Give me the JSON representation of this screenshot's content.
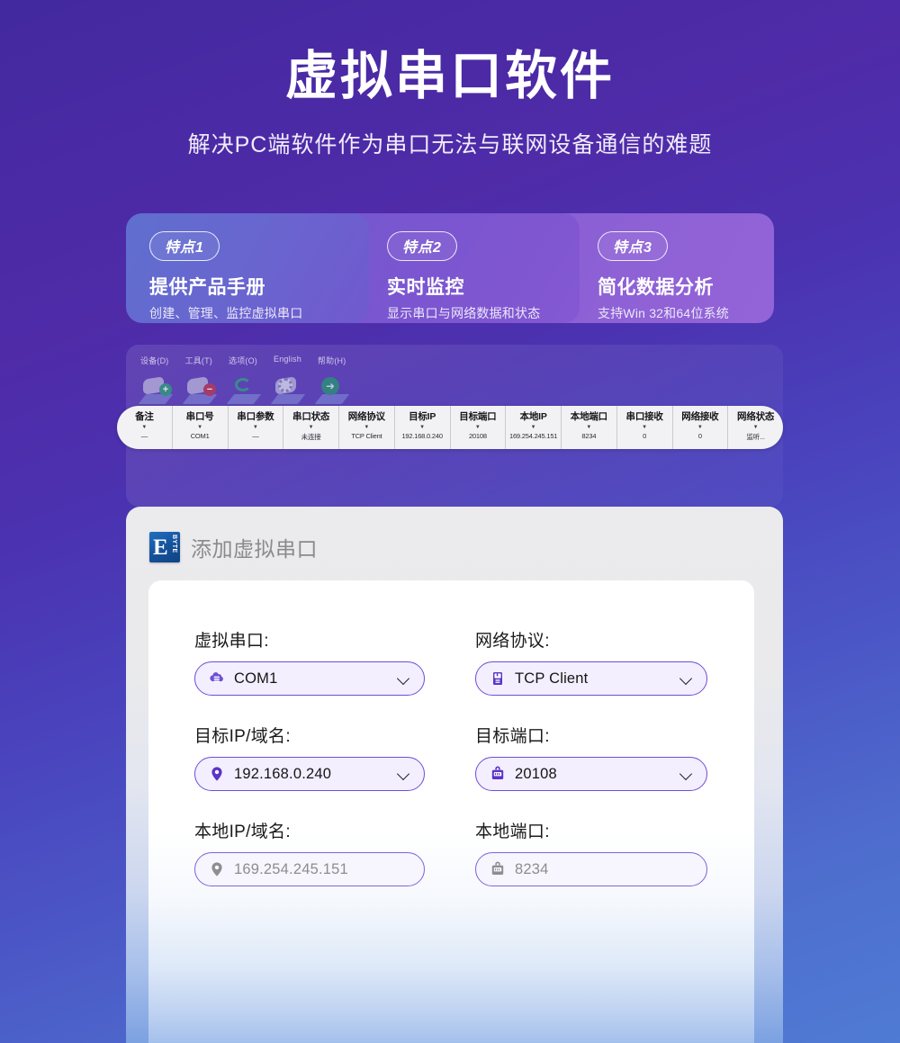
{
  "hero": {
    "title": "虚拟串口软件",
    "subtitle": "解决PC端软件作为串口无法与联网设备通信的难题"
  },
  "features": [
    {
      "badge": "特点1",
      "title": "提供产品手册",
      "desc": "创建、管理、监控虚拟串口",
      "color": "#6b63cf"
    },
    {
      "badge": "特点2",
      "title": "实时监控",
      "desc": "显示串口与网络数据和状态",
      "color": "#7e56d0"
    },
    {
      "badge": "特点3",
      "title": "简化数据分析",
      "desc": "支持Win 32和64位系统",
      "color": "#9062d6"
    }
  ],
  "app_window": {
    "menubar": [
      "设备(D)",
      "工具(T)",
      "选项(O)",
      "English",
      "帮助(H)"
    ],
    "toolbar": [
      {
        "name": "add-device-button",
        "glyph": "+"
      },
      {
        "name": "remove-device-button",
        "glyph": "−"
      },
      {
        "name": "refresh-button",
        "glyph": "↻"
      },
      {
        "name": "settings-button",
        "glyph": ""
      },
      {
        "name": "start-button",
        "glyph": "➜"
      }
    ],
    "table": {
      "columns": [
        {
          "header": "备注",
          "value": "—"
        },
        {
          "header": "串口号",
          "value": "COM1"
        },
        {
          "header": "串口参数",
          "value": "—"
        },
        {
          "header": "串口状态",
          "value": "未连接"
        },
        {
          "header": "网络协议",
          "value": "TCP Client"
        },
        {
          "header": "目标IP",
          "value": "192.168.0.240"
        },
        {
          "header": "目标端口",
          "value": "20108"
        },
        {
          "header": "本地IP",
          "value": "169.254.245.151"
        },
        {
          "header": "本地端口",
          "value": "8234"
        },
        {
          "header": "串口接收",
          "value": "0"
        },
        {
          "header": "网络接收",
          "value": "0"
        },
        {
          "header": "网络状态",
          "value": "监听..."
        }
      ],
      "sort_arrow": "▼"
    }
  },
  "dialog": {
    "logo_letter": "E",
    "logo_word": "BYTE",
    "title": "添加虚拟串口",
    "fields": [
      {
        "label": "虚拟串口:",
        "value": "COM1",
        "icon": "server-stack-icon",
        "disabled": false,
        "name": "virtual-serial-port"
      },
      {
        "label": "网络协议:",
        "value": "TCP Client",
        "icon": "protocol-device-icon",
        "disabled": false,
        "name": "network-protocol"
      },
      {
        "label": "目标IP/域名:",
        "value": "192.168.0.240",
        "icon": "location-pin-icon",
        "disabled": false,
        "name": "target-ip"
      },
      {
        "label": "目标端口:",
        "value": "20108",
        "icon": "port-icon",
        "disabled": false,
        "name": "target-port"
      },
      {
        "label": "本地IP/域名:",
        "value": "169.254.245.151",
        "icon": "location-pin-icon",
        "disabled": true,
        "name": "local-ip"
      },
      {
        "label": "本地端口:",
        "value": "8234",
        "icon": "port-icon",
        "disabled": true,
        "name": "local-port"
      }
    ]
  },
  "colors": {
    "bg_top": "#42299f",
    "bg_bottom": "#4f7bd4",
    "accent": "#6d4fd6",
    "logo_blue": "#15509a"
  }
}
